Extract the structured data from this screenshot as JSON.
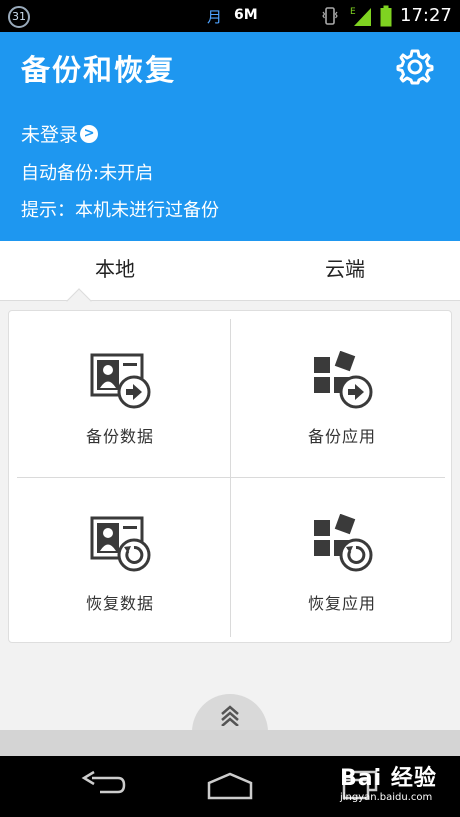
{
  "status_bar": {
    "calendar_day": "31",
    "month_glyph": "月",
    "data_amount": "6M",
    "signal_type": "E",
    "time": "17:27"
  },
  "header": {
    "title": "备份和恢复",
    "login_text": "未登录",
    "auto_backup": "自动备份:未开启",
    "hint": "提示：本机未进行过备份"
  },
  "tabs": {
    "local": "本地",
    "cloud": "云端"
  },
  "actions": {
    "backup_data": "备份数据",
    "backup_apps": "备份应用",
    "restore_data": "恢复数据",
    "restore_apps": "恢复应用"
  },
  "watermark": {
    "logo": "Bai 经验",
    "site": "jingyan.baidu.com"
  },
  "colors": {
    "header_blue": "#1e97f0",
    "icon_gray": "#3a3a3a"
  }
}
